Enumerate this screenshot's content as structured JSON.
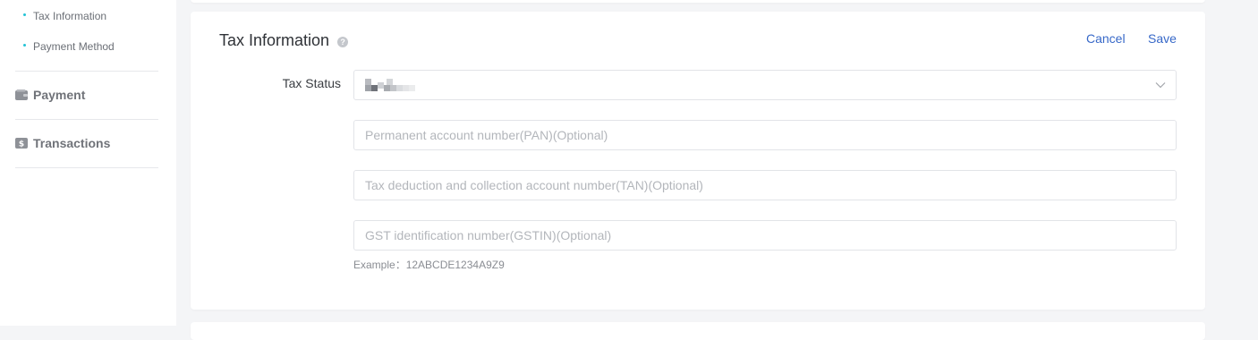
{
  "sidebar": {
    "sub_items": [
      {
        "label": "Tax Information"
      },
      {
        "label": "Payment Method"
      }
    ],
    "sections": [
      {
        "label": "Payment",
        "icon": "wallet-icon"
      },
      {
        "label": "Transactions",
        "icon": "transactions-icon"
      }
    ]
  },
  "tax_card": {
    "title": "Tax Information",
    "help_icon": "help-icon",
    "cancel_label": "Cancel",
    "save_label": "Save",
    "tax_status_label": "Tax Status",
    "tax_status_select_icon": "chevron-down-icon",
    "fields": [
      {
        "placeholder": "Permanent account number(PAN)(Optional)"
      },
      {
        "placeholder": "Tax deduction and collection account number(TAN)(Optional)"
      },
      {
        "placeholder": "GST identification number(GSTIN)(Optional)"
      }
    ],
    "example_hint": "Example：12ABCDE1234A9Z9"
  },
  "colors": {
    "accent_link": "#3768c8",
    "bullet": "#22c3d6",
    "page_background": "#f4f5f7"
  }
}
